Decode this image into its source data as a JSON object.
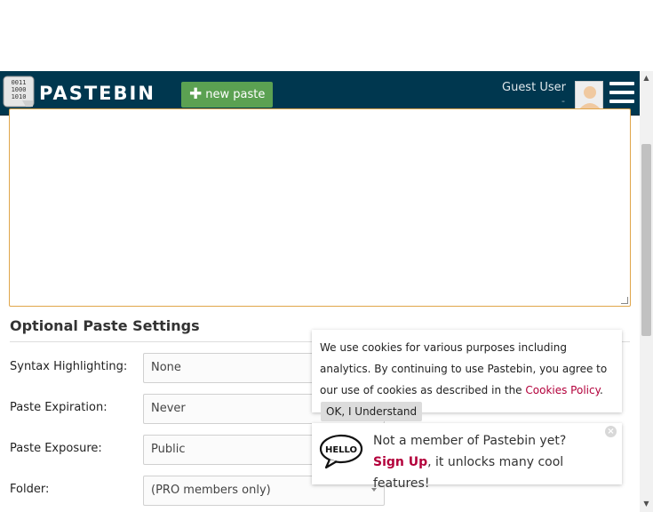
{
  "header": {
    "logo_text": "PASTEBIN",
    "new_paste_label": "new paste",
    "user_name": "Guest User",
    "user_sub": "-"
  },
  "settings": {
    "title": "Optional Paste Settings",
    "rows": [
      {
        "label": "Syntax Highlighting:",
        "value": "None"
      },
      {
        "label": "Paste Expiration:",
        "value": "Never"
      },
      {
        "label": "Paste Exposure:",
        "value": "Public"
      },
      {
        "label": "Folder:",
        "value": "(PRO members only)"
      }
    ]
  },
  "cookie": {
    "text_before": "We use cookies for various purposes including analytics. By continuing to use Pastebin, you agree to our use of cookies as described in the ",
    "link_text": "Cookies Policy",
    "text_after": ".",
    "ok_label": "OK, I Understand"
  },
  "signup": {
    "line1": "Not a member of Pastebin yet?",
    "signup_link": "Sign Up",
    "line2": ", it unlocks many cool features!",
    "icon_text": "HELLO"
  },
  "colors": {
    "header_bg": "#00374f",
    "new_paste_bg": "#5ba152",
    "link": "#b3003b",
    "textarea_border": "#e0a64a"
  }
}
